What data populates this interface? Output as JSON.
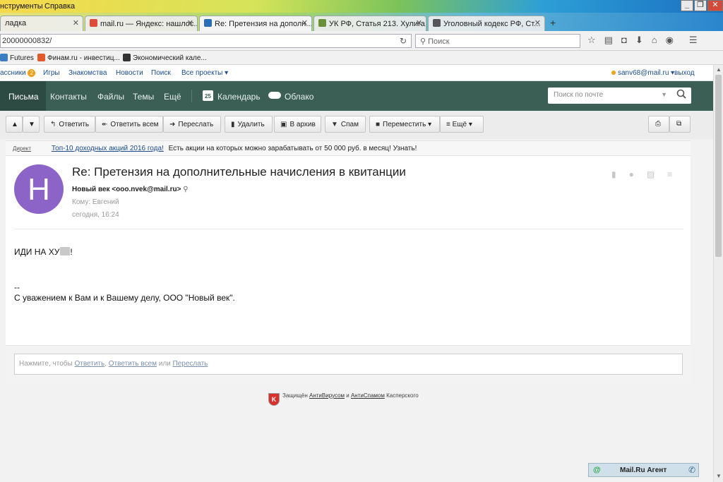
{
  "browser": {
    "menu": [
      "нструменты",
      "Справка"
    ],
    "tabs": [
      {
        "label": "ладка",
        "color": "#f5c33b"
      },
      {
        "label": "mail.ru — Яндекс: нашлос...",
        "color": "#e04b3a"
      },
      {
        "label": "Re: Претензия на дополн...",
        "color": "#2a6fb5"
      },
      {
        "label": "УК РФ, Статья 213. Хулига...",
        "color": "#6a8f3a"
      },
      {
        "label": "Уголовный кодекс РФ, Ст...",
        "color": "#555555"
      }
    ],
    "new_tab": "+",
    "url": "20000000832/",
    "search_placeholder": "Поиск",
    "bookmarks": [
      {
        "label": "Futures",
        "color": "#3a7fc4"
      },
      {
        "label": "Финам.ru - инвестиц...",
        "color": "#e05a2b"
      },
      {
        "label": "Экономический кале...",
        "color": "#333333"
      }
    ]
  },
  "portal": {
    "links": [
      "ассники",
      "Игры",
      "Знакомства",
      "Новости",
      "Поиск",
      "Все проекты ▾"
    ],
    "badge": "2",
    "user": "sanv68@mail.ru ▾",
    "logout": "выход"
  },
  "mailnav": {
    "items": [
      "Письма",
      "Контакты",
      "Файлы",
      "Темы",
      "Ещё"
    ],
    "calendar": "Календарь",
    "calendar_day": "25",
    "cloud": "Облако",
    "search_placeholder": "Поиск по почте"
  },
  "toolbar": {
    "reply": "Ответить",
    "reply_all": "Ответить всем",
    "forward": "Переслать",
    "delete": "Удалить",
    "archive": "В архив",
    "spam": "Спам",
    "move": "Переместить ▾",
    "more": "≡ Ещё ▾"
  },
  "ad": {
    "label": "Директ",
    "link": "Топ-10 доходных акций 2016 года!",
    "text": "Есть акции на которых можно зарабатывать от 50 000 руб. в месяц! Узнать!"
  },
  "message": {
    "avatar_letter": "Н",
    "avatar_color": "#8c63c6",
    "subject": "Re: Претензия на дополнительные начисления в квитанции",
    "from": "Новый век <ooo.nvek@mail.ru>",
    "to": "Кому: Евгений",
    "date": "сегодня, 16:24",
    "body_line1_a": "ИДИ НА ХУ",
    "body_line1_b": "!",
    "signature_sep": "--",
    "signature": "С уважением к Вам и к Вашему делу, ООО \"Новый век\"."
  },
  "reply": {
    "prefix": "Нажмите, чтобы",
    "reply": "Ответить",
    "comma": ",",
    "reply_all": "Ответить всем",
    "or": "или",
    "forward": "Переслать"
  },
  "footer": {
    "shield": "K",
    "protected": "Защищён",
    "antivirus": "АнтиВирусом",
    "and": "и",
    "antispam": "АнтиСпамом",
    "vendor": "Касперского"
  },
  "agent": {
    "label": "Mail.Ru Агент"
  },
  "colors": {
    "mail_green": "#3b5e55",
    "link_blue": "#1a4c8f"
  }
}
